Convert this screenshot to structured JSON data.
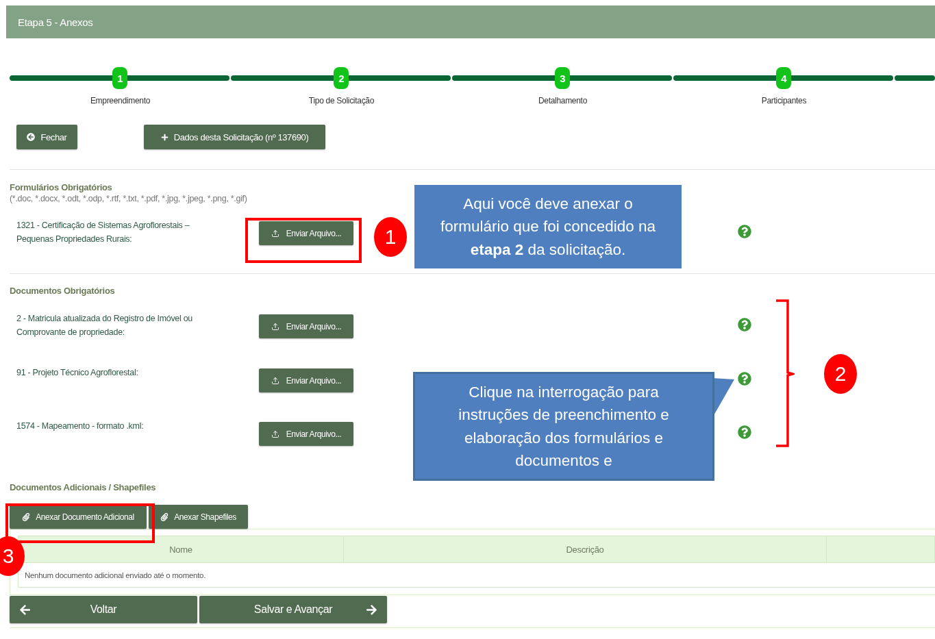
{
  "window": {
    "title": "Etapa 5 - Anexos"
  },
  "stepper": {
    "steps": [
      {
        "number": "1",
        "label": "Empreendimento"
      },
      {
        "number": "2",
        "label": "Tipo de Solicitação"
      },
      {
        "number": "3",
        "label": "Detalhamento"
      },
      {
        "number": "4",
        "label": "Participantes"
      }
    ]
  },
  "actions": [
    {
      "kind": "close",
      "label": "Fechar"
    },
    {
      "kind": "details",
      "label": "Dados desta Solicitação (nº 137690)"
    }
  ],
  "forms_section": {
    "title": "Formulários Obrigatórios",
    "hint": "(*.doc, *.docx, *.odt, *.odp, *.rtf, *.txt, *.pdf, *.jpg, *.jpeg, *.png, *.gif)",
    "items": [
      {
        "label": "1321 - Certificação de Sistemas Agroflorestais – Pequenas Propriedades Rurais:",
        "button": "Enviar Arquivo..."
      }
    ]
  },
  "documents_section": {
    "title": "Documentos Obrigatórios",
    "items": [
      {
        "label": "2 - Matricula atualizada do Registro de Imóvel ou Comprovante de propriedade:",
        "button": "Enviar Arquivo..."
      },
      {
        "label": "91 - Projeto Técnico Agroflorestal:",
        "button": "Enviar Arquivo..."
      },
      {
        "label": "1574 - Mapeamento - formato .kml:",
        "button": "Enviar Arquivo..."
      }
    ]
  },
  "additional_section": {
    "title": "Documentos Adicionais / Shapefiles",
    "buttons": [
      "Anexar Documento Adicional",
      "Anexar Shapefiles"
    ],
    "table": {
      "columns": [
        "Nome",
        "Descrição"
      ],
      "empty_message": "Nenhum documento adicional enviado até o momento."
    }
  },
  "footer": {
    "back": "Voltar",
    "next": "Salvar e Avançar"
  },
  "annotations": {
    "callouts": [
      "Aqui você deve anexar o formulário que foi concedido na **etapa 2** da solicitação.",
      "Clique na interrogação para instruções de preenchimento e elaboração dos formulários e documentos e"
    ],
    "markers": [
      "1",
      "2",
      "3"
    ]
  }
}
